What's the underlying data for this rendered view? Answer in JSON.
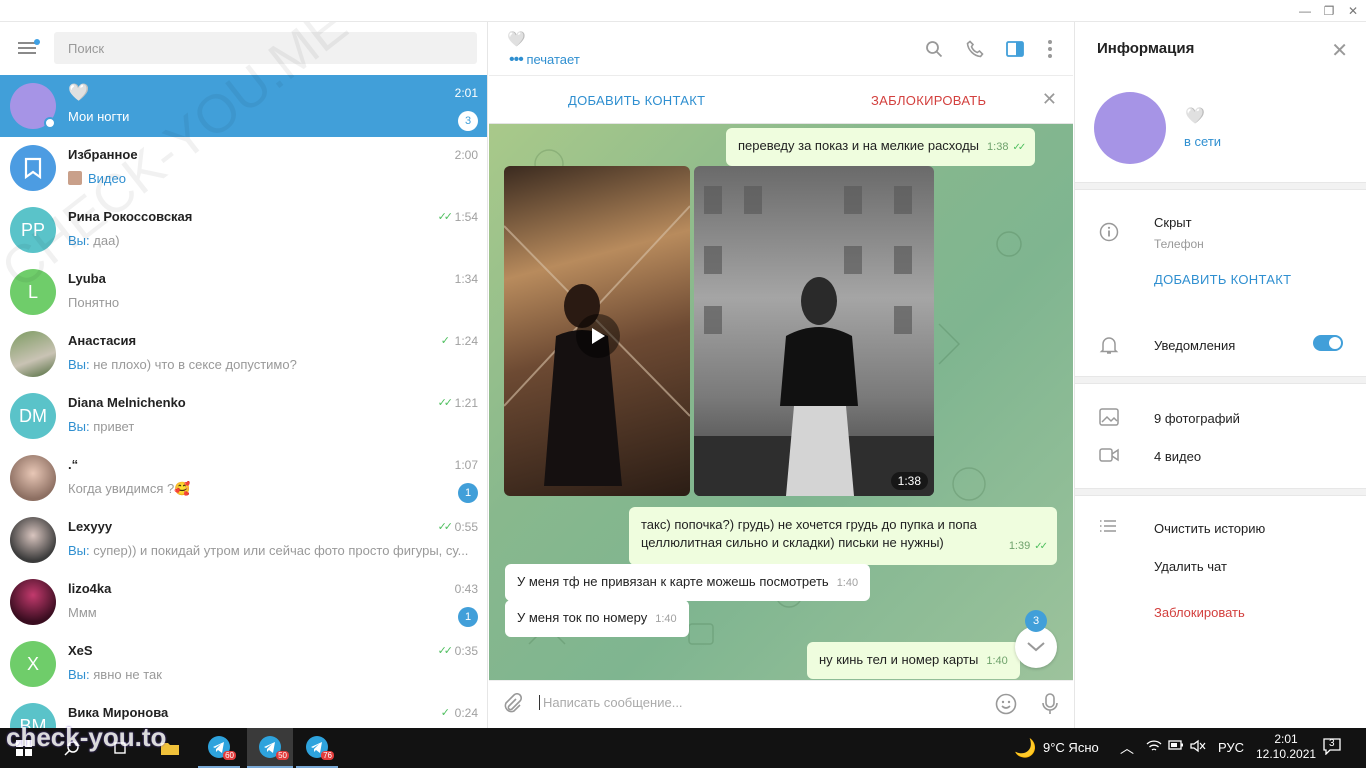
{
  "sidebar": {
    "search_placeholder": "Поиск",
    "chats": [
      {
        "name": "🤍",
        "message": "Мои ногти",
        "time": "2:01",
        "badge": "3",
        "active": true,
        "avatar_color": "#a694e6",
        "initials": ""
      },
      {
        "name": "Избранное",
        "message": "Видео",
        "time": "2:00",
        "avatar_color": "#4c9ce2",
        "initials": "🔖"
      },
      {
        "name": "Рина Рокоссовская",
        "you": "Вы:",
        "message": " даа)",
        "time": "1:54",
        "read": true,
        "avatar_color": "#5ac3c9",
        "initials": "PP"
      },
      {
        "name": "Lyuba",
        "message": "Понятно",
        "time": "1:34",
        "avatar_color": "#6fcd6a",
        "initials": "L"
      },
      {
        "name": "Анастасия",
        "you": "Вы:",
        "message": " не плохо) что в сексе допустимо?",
        "time": "1:24",
        "read": true,
        "avatar_color": "#5b7a4a",
        "initials": ""
      },
      {
        "name": "Diana Melnichenko",
        "you": "Вы:",
        "message": " привет",
        "time": "1:21",
        "read": true,
        "avatar_color": "#5ac3c9",
        "initials": "DM"
      },
      {
        "name": ".“",
        "message": "Когда увидимся ?🥰",
        "time": "1:07",
        "badge": "1",
        "avatar_color": "#8d6f62",
        "initials": ""
      },
      {
        "name": "Lexyyy",
        "you": "Вы:",
        "message": " супер)) и покидай утром или сейчас фото просто фигуры, су...",
        "time": "0:55",
        "read": true,
        "avatar_color": "#3b3b3b",
        "initials": ""
      },
      {
        "name": "lizo4ka",
        "message": "Ммм",
        "time": "0:43",
        "badge": "1",
        "avatar_color": "#5a1533",
        "initials": ""
      },
      {
        "name": "XeS",
        "you": "Вы:",
        "message": " явно не так",
        "time": "0:35",
        "read": true,
        "avatar_color": "#6fcd6a",
        "initials": "X"
      },
      {
        "name": "Вика Миронова",
        "message": "",
        "time": "0:24",
        "read": true,
        "avatar_color": "#5ac3c9",
        "initials": "ВМ"
      }
    ]
  },
  "header": {
    "name": "🤍",
    "status": "печатает"
  },
  "action_bar": {
    "add_contact": "ДОБАВИТЬ КОНТАКТ",
    "block": "ЗАБЛОКИРОВАТЬ"
  },
  "messages": {
    "m1": {
      "text": "переведу за показ и на мелкие расходы",
      "time": "1:38"
    },
    "media_time": "1:38",
    "m2": {
      "text": "такс) попочка?) грудь) не хочется грудь до пупка и попа целлюлитная сильно и складки) письки не нужны)",
      "time": "1:39"
    },
    "m3": {
      "text": "У меня тф не привязан к карте можешь посмотреть",
      "time": "1:40"
    },
    "m4": {
      "text": "У меня ток по номеру",
      "time": "1:40"
    },
    "m5": {
      "text": "ну кинь тел и номер карты",
      "time": "1:40"
    },
    "unread_badge": "3"
  },
  "composer": {
    "placeholder": "Написать сообщение..."
  },
  "info": {
    "title": "Информация",
    "name": "🤍",
    "online": "в сети",
    "phone_value": "Скрыт",
    "phone_label": "Телефон",
    "add_contact": "ДОБАВИТЬ КОНТАКТ",
    "notifications": "Уведомления",
    "notifications_on": true,
    "photos": "9 фотографий",
    "videos": "4 видео",
    "clear_history": "Очистить историю",
    "delete_chat": "Удалить чат",
    "block": "Заблокировать"
  },
  "taskbar": {
    "weather": "9°C Ясно",
    "lang": "РУС",
    "time": "2:01",
    "date": "12.10.2021",
    "notif_count": "3",
    "tg_badges": [
      "60",
      "50",
      "76"
    ]
  },
  "watermark": "check-you.to",
  "diagonal_watermark": "CHECK-YOU.ME",
  "colors": {
    "accent": "#419fd9",
    "danger": "#d3403e",
    "read_ticks": "#4fbf5f"
  }
}
